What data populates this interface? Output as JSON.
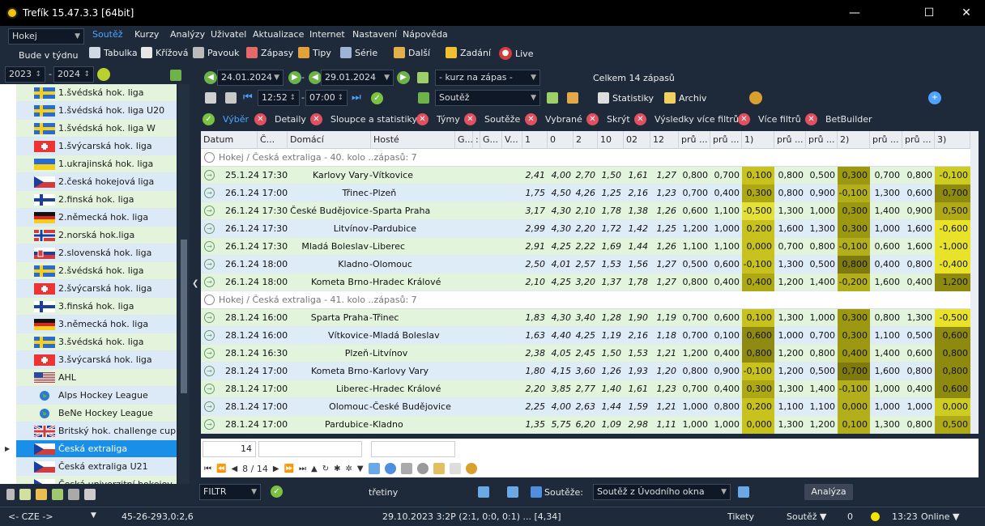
{
  "window": {
    "title": "Trefík 15.47.3.3 [64bit]"
  },
  "menu": {
    "sport_select": "Hokej",
    "items": [
      "Soutěž",
      "Kurzy",
      "Analýzy",
      "Uživatel",
      "Aktualizace",
      "Internet",
      "Nastavení",
      "Nápověda"
    ]
  },
  "toolbar": {
    "period": "Bude v týdnu",
    "year_from": "2023",
    "year_to": "2024",
    "buttons": [
      "Tabulka",
      "Křížová",
      "Pavouk",
      "Zápasy",
      "Tipy",
      "Série",
      "Další",
      "Zadání",
      "Live"
    ]
  },
  "filters": {
    "date_from": "24.01.2024",
    "date_to": "29.01.2024",
    "odds_select": "- kurz na zápas -",
    "total": "Celkem 14 zápasů",
    "time_from": "12:52",
    "time_to": "07:00",
    "competition_select": "Soutěž",
    "statistiky": "Statistiky",
    "archiv": "Archiv"
  },
  "tabs": [
    "Výběr",
    "Detaily",
    "Sloupce a statistiky",
    "Týmy",
    "Soutěže",
    "Vybrané",
    "Skrýt",
    "Výsledky více filtrů",
    "Více filtrů",
    "BetBuilder"
  ],
  "sidebar": {
    "items": [
      {
        "label": "1.švédská hok. liga",
        "flag": "se"
      },
      {
        "label": "1.švédská hok. liga U20",
        "flag": "se"
      },
      {
        "label": "1.švédská hok. liga W",
        "flag": "se"
      },
      {
        "label": "1.švýcarská hok. liga",
        "flag": "ch"
      },
      {
        "label": "1.ukrajinská hok. liga",
        "flag": "ua"
      },
      {
        "label": "2.česká hokejová liga",
        "flag": "cz"
      },
      {
        "label": "2.finská hok. liga",
        "flag": "fi"
      },
      {
        "label": "2.německá hok. liga",
        "flag": "de"
      },
      {
        "label": "2.norská hok.liga",
        "flag": "no"
      },
      {
        "label": "2.slovenská hok. liga",
        "flag": "sk"
      },
      {
        "label": "2.švédská hok. liga",
        "flag": "se"
      },
      {
        "label": "2.švýcarská hok. liga",
        "flag": "ch"
      },
      {
        "label": "3.finská hok. liga",
        "flag": "fi"
      },
      {
        "label": "3.německá hok. liga",
        "flag": "de"
      },
      {
        "label": "3.švédská hok. liga",
        "flag": "se"
      },
      {
        "label": "3.švýcarská hok. liga",
        "flag": "ch"
      },
      {
        "label": "AHL",
        "flag": "us"
      },
      {
        "label": "Alps Hockey League",
        "flag": "globe"
      },
      {
        "label": "BeNe Hockey League",
        "flag": "globe"
      },
      {
        "label": "Britský hok. challenge cup",
        "flag": "gb"
      },
      {
        "label": "Česká extraliga",
        "flag": "cz",
        "selected": true
      },
      {
        "label": "Česká extraliga U21",
        "flag": "cz"
      },
      {
        "label": "Česká univerzitní hokejov",
        "flag": "cz"
      }
    ]
  },
  "grid": {
    "columns": [
      "Datum",
      "Č...",
      "Domácí",
      "Hosté",
      "G...",
      ":",
      "G...",
      "V...",
      "1",
      "0",
      "2",
      "10",
      "02",
      "12",
      "prů ...",
      "prů ...",
      "1)",
      "prů ...",
      "prů ...",
      "2)",
      "prů ...",
      "prů ...",
      "3)"
    ],
    "groups": [
      {
        "label": "Hokej / Česká extraliga - 40. kolo ..zápasů: 7",
        "rows": [
          [
            "25.1.24 17:30",
            "Karlovy Vary",
            "Vítkovice",
            "2,41",
            "4,00",
            "2,70",
            "1,50",
            "1,61",
            "1,27",
            "0,800",
            "0,700",
            "0,100",
            "0,800",
            "0,500",
            "0,300",
            "0,700",
            "0,800",
            "-0,100"
          ],
          [
            "26.1.24 17:00",
            "Třinec",
            "Plzeň",
            "1,75",
            "4,50",
            "4,26",
            "1,25",
            "2,16",
            "1,23",
            "0,700",
            "0,400",
            "0,300",
            "0,800",
            "0,900",
            "-0,100",
            "1,300",
            "0,600",
            "0,700"
          ],
          [
            "26.1.24 17:30",
            "České Budějovice",
            "Sparta Praha",
            "3,17",
            "4,30",
            "2,10",
            "1,78",
            "1,38",
            "1,26",
            "0,600",
            "1,100",
            "-0,500",
            "1,300",
            "1,000",
            "0,300",
            "1,400",
            "0,900",
            "0,500"
          ],
          [
            "26.1.24 17:30",
            "Litvínov",
            "Pardubice",
            "2,99",
            "4,30",
            "2,20",
            "1,72",
            "1,42",
            "1,25",
            "1,200",
            "1,000",
            "0,200",
            "1,600",
            "1,300",
            "0,300",
            "1,000",
            "1,600",
            "-0,600"
          ],
          [
            "26.1.24 17:30",
            "Mladá Boleslav",
            "Liberec",
            "2,91",
            "4,25",
            "2,22",
            "1,69",
            "1,44",
            "1,26",
            "1,100",
            "1,100",
            "0,000",
            "0,700",
            "0,800",
            "-0,100",
            "0,600",
            "1,600",
            "-1,000"
          ],
          [
            "26.1.24 18:00",
            "Kladno",
            "Olomouc",
            "2,50",
            "4,01",
            "2,57",
            "1,53",
            "1,56",
            "1,27",
            "0,500",
            "0,600",
            "-0,100",
            "1,300",
            "0,500",
            "0,800",
            "0,400",
            "0,800",
            "-0,400"
          ],
          [
            "26.1.24 18:00",
            "Kometa Brno",
            "Hradec Králové",
            "2,10",
            "4,25",
            "3,20",
            "1,37",
            "1,78",
            "1,27",
            "0,800",
            "0,400",
            "0,400",
            "1,200",
            "1,400",
            "-0,200",
            "1,600",
            "0,400",
            "1,200"
          ]
        ]
      },
      {
        "label": "Hokej / Česká extraliga - 41. kolo ..zápasů: 7",
        "rows": [
          [
            "28.1.24 16:00",
            "Sparta Praha",
            "Třinec",
            "1,83",
            "4,30",
            "3,40",
            "1,28",
            "1,90",
            "1,19",
            "0,700",
            "0,600",
            "0,100",
            "1,300",
            "1,000",
            "0,300",
            "0,800",
            "1,300",
            "-0,500"
          ],
          [
            "28.1.24 16:00",
            "Vítkovice",
            "Mladá Boleslav",
            "1,63",
            "4,40",
            "4,25",
            "1,19",
            "2,16",
            "1,18",
            "0,700",
            "0,100",
            "0,600",
            "1,000",
            "0,700",
            "0,300",
            "1,100",
            "0,500",
            "0,600"
          ],
          [
            "28.1.24 16:30",
            "Plzeň",
            "Litvínov",
            "2,38",
            "4,05",
            "2,45",
            "1,50",
            "1,53",
            "1,21",
            "1,200",
            "0,400",
            "0,800",
            "1,200",
            "0,800",
            "0,400",
            "1,400",
            "0,600",
            "0,800"
          ],
          [
            "28.1.24 17:00",
            "Kometa Brno",
            "Karlovy Vary",
            "1,80",
            "4,15",
            "3,60",
            "1,26",
            "1,93",
            "1,20",
            "0,800",
            "0,900",
            "-0,100",
            "1,200",
            "0,500",
            "0,700",
            "1,600",
            "0,800",
            "0,800"
          ],
          [
            "28.1.24 17:00",
            "Liberec",
            "Hradec Králové",
            "2,20",
            "3,85",
            "2,77",
            "1,40",
            "1,61",
            "1,23",
            "0,700",
            "0,400",
            "0,300",
            "1,300",
            "1,400",
            "-0,100",
            "1,000",
            "0,400",
            "0,600"
          ],
          [
            "28.1.24 17:00",
            "Olomouc",
            "České Budějovice",
            "2,25",
            "4,00",
            "2,63",
            "1,44",
            "1,59",
            "1,21",
            "1,000",
            "0,800",
            "0,200",
            "1,100",
            "1,100",
            "0,000",
            "1,000",
            "1,000",
            "0,000"
          ],
          [
            "28.1.24 17:00",
            "Pardubice",
            "Kladno",
            "1,35",
            "5,75",
            "6,20",
            "1,09",
            "2,98",
            "1,11",
            "1,000",
            "1,000",
            "0,000",
            "1,300",
            "1,200",
            "0,100",
            "1,300",
            "0,800",
            "0,500"
          ]
        ]
      }
    ],
    "footer_count": "14",
    "pager": "8 / 14"
  },
  "bottom": {
    "filtr": "FILTR",
    "tretiny": "třetiny",
    "souteze_label": "Soutěže:",
    "souteze_select": "Soutěž z Úvodního okna",
    "analyza": "Analýza"
  },
  "status": {
    "country": "<- CZE ->",
    "record": "45-26-29",
    "score": "3,0:2,6",
    "last": "29.10.2023 3:2P (2:1, 0:0, 0:1) ... [4,34]",
    "tikety": "Tikety",
    "soutez": "Soutěž ▼",
    "zero": "0",
    "time": "13:23",
    "online": "Online ▼"
  }
}
